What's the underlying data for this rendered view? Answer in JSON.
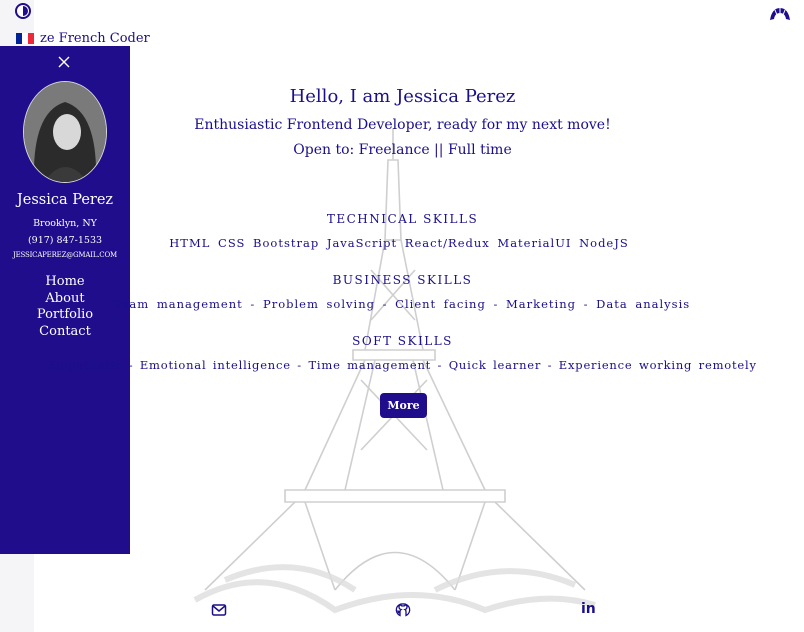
{
  "brand": {
    "name": "ze French Coder"
  },
  "sidebar": {
    "name": "Jessica Perez",
    "location": "Brooklyn, NY",
    "phone": "(917) 847-1533",
    "email": "JESSICAPEREZ@GMAIL.COM",
    "nav": [
      "Home",
      "About",
      "Portfolio",
      "Contact"
    ]
  },
  "hero": {
    "title": "Hello, I am Jessica Perez",
    "subtitle": "Enthusiastic Frontend Developer, ready for my next move!",
    "open_to": "Open to: Freelance || Full time"
  },
  "skills": {
    "technical_heading": "TECHNICAL SKILLS",
    "technical": "HTML CSS Bootstrap JavaScript React/Redux MaterialUI NodeJS",
    "business_heading": "BUSINESS SKILLS",
    "business": "Team management - Problem solving - Client facing - Marketing - Data analysis",
    "soft_heading": "SOFT SKILLS",
    "soft": "Empathetic - Emotional intelligence - Time management - Quick learner - Experience working remotely"
  },
  "more_button": "More",
  "colors": {
    "accent": "#1f0d8c",
    "text": "#1a0f8a",
    "flag_blue": "#002395",
    "flag_red": "#ed2939"
  },
  "icons": {
    "logo": "half-circle-logo-icon",
    "croissant": "croissant-icon",
    "close": "close-icon",
    "mail": "mail-icon",
    "github": "github-icon",
    "linkedin": "linkedin-icon"
  },
  "footer": {
    "linkedin_glyph": "in"
  }
}
